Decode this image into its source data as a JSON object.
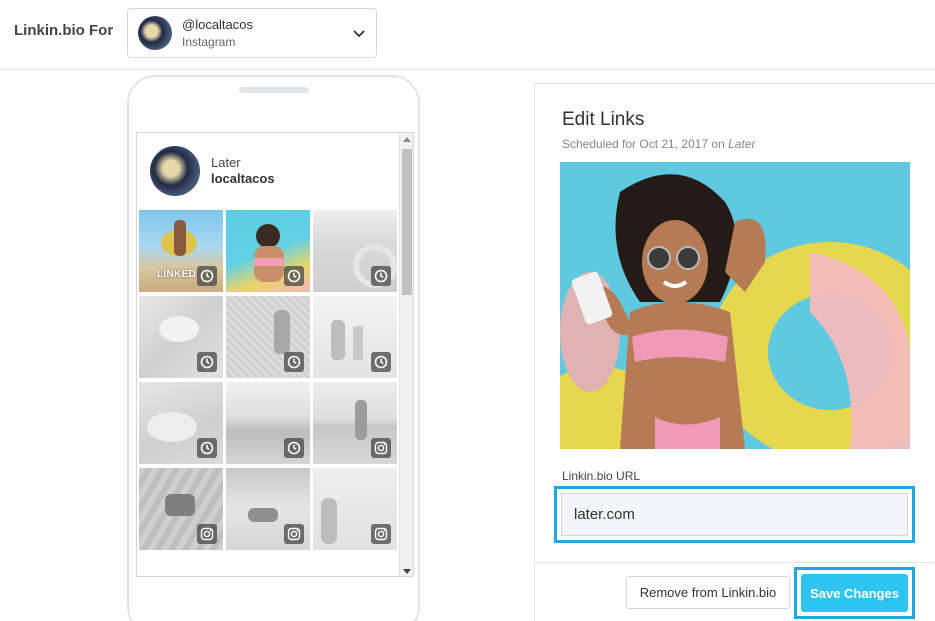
{
  "header": {
    "label": "Linkin.bio For",
    "account": {
      "handle": "@localtacos",
      "platform": "Instagram",
      "icon": "chevron-down-icon"
    }
  },
  "preview": {
    "profile": {
      "name": "Later",
      "username": "localtacos"
    },
    "tiles": [
      {
        "status": "linked",
        "label": "LINKED",
        "icon": "clock-icon",
        "color": true
      },
      {
        "status": "selected",
        "icon": "clock-icon",
        "color": true
      },
      {
        "status": "scheduled",
        "icon": "clock-icon"
      },
      {
        "status": "scheduled",
        "icon": "clock-icon"
      },
      {
        "status": "scheduled",
        "icon": "clock-icon"
      },
      {
        "status": "scheduled",
        "icon": "clock-icon"
      },
      {
        "status": "scheduled",
        "icon": "clock-icon"
      },
      {
        "status": "scheduled",
        "icon": "clock-icon"
      },
      {
        "status": "posted",
        "icon": "instagram-icon"
      },
      {
        "status": "posted",
        "icon": "instagram-icon"
      },
      {
        "status": "posted",
        "icon": "instagram-icon"
      },
      {
        "status": "posted",
        "icon": "instagram-icon"
      }
    ]
  },
  "editor": {
    "title": "Edit Links",
    "scheduled_prefix": "Scheduled for Oct 21, 2017 on ",
    "scheduled_platform": "Later",
    "url_label": "Linkin.bio URL",
    "url_value": "later.com",
    "remove_label": "Remove from Linkin.bio",
    "save_label": "Save Changes"
  },
  "colors": {
    "accent": "#1fa7e0",
    "save_button": "#2ec4f0"
  }
}
